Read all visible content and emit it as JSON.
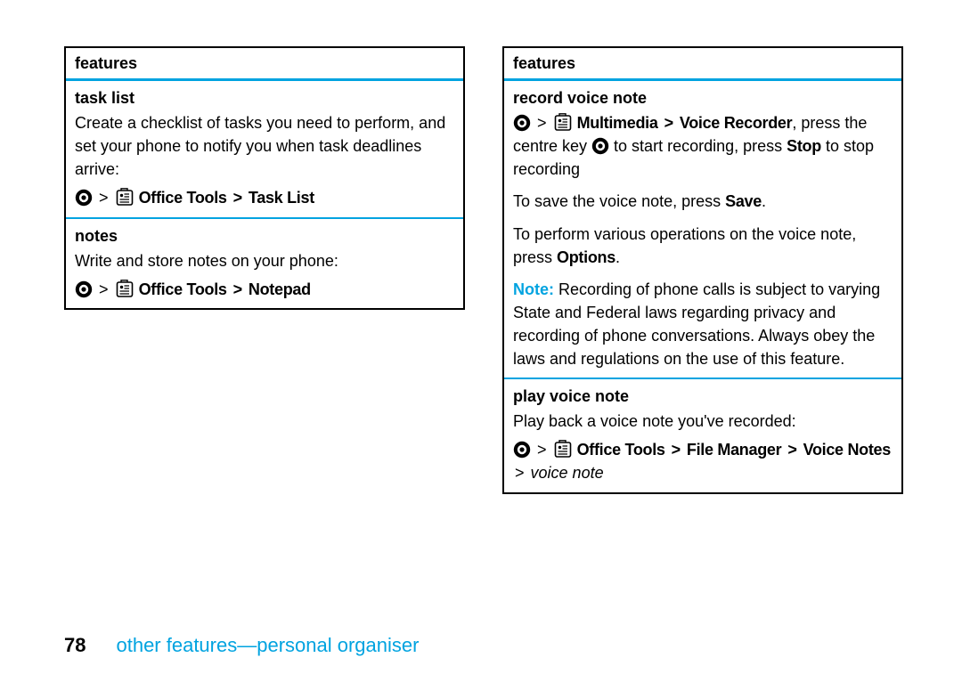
{
  "page_number": "78",
  "footer_title": "other features—personal organiser",
  "left": {
    "header": "features",
    "task_list": {
      "title": "task list",
      "body": "Create a checklist of tasks you need to perform, and set your phone to notify you when task deadlines arrive:",
      "path1": "Office Tools",
      "path2": "Task List"
    },
    "notes": {
      "title": "notes",
      "body": "Write and store notes on your phone:",
      "path1": "Office Tools",
      "path2": "Notepad"
    }
  },
  "right": {
    "header": "features",
    "record": {
      "title": "record voice note",
      "path_multimedia": "Multimedia",
      "path_voice_recorder": "Voice Recorder",
      "after_path_1a": ", press the centre key ",
      "after_path_1b": " to start recording, press ",
      "stop": "Stop",
      "after_stop": " to stop recording",
      "save_line_a": "To save the voice note, press ",
      "save": "Save",
      "save_line_b": ".",
      "options_line_a": "To perform various operations on the voice note, press ",
      "options": "Options",
      "options_line_b": ".",
      "note_label": "Note:",
      "note_body": " Recording of phone calls is subject to varying State and Federal laws regarding privacy and recording of phone conversations. Always obey the laws and regulations on the use of this feature."
    },
    "play": {
      "title": "play voice note",
      "body": "Play back a voice note you've recorded:",
      "path1": "Office Tools",
      "path2": "File Manager",
      "path3": "Voice Notes",
      "trail": "voice note"
    }
  }
}
